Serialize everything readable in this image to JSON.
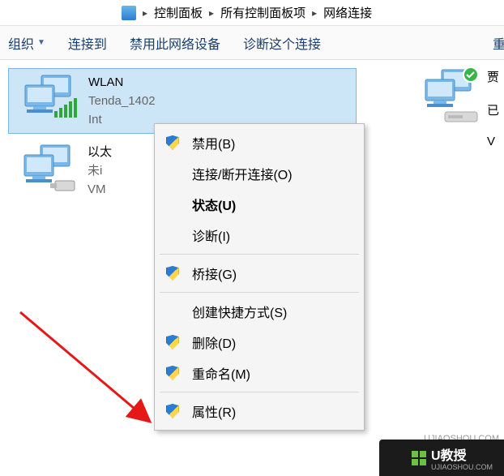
{
  "breadcrumb": {
    "item1": "控制面板",
    "item2": "所有控制面板项",
    "item3": "网络连接"
  },
  "toolbar": {
    "organize": "组织",
    "connect_to": "连接到",
    "disable_device": "禁用此网络设备",
    "diagnose": "诊断这个连接",
    "more": "重"
  },
  "adapter_wlan": {
    "name": "WLAN",
    "ssid": "Tenda_1402",
    "driver": "Int"
  },
  "adapter_eth": {
    "name": "以太",
    "status": "未i",
    "driver": "VM"
  },
  "adapter_right": {
    "line1": "贾",
    "line2": "已",
    "line3": "V"
  },
  "context_menu": {
    "disable": "禁用(B)",
    "connect_disconnect": "连接/断开连接(O)",
    "status": "状态(U)",
    "diagnose": "诊断(I)",
    "bridge": "桥接(G)",
    "create_shortcut": "创建快捷方式(S)",
    "delete": "删除(D)",
    "rename": "重命名(M)",
    "properties": "属性(R)"
  },
  "watermarks": {
    "url": "UJIAOSHOU.COM",
    "brand": "U教授",
    "brand_sub": "UJIAOSHOU.COM"
  }
}
